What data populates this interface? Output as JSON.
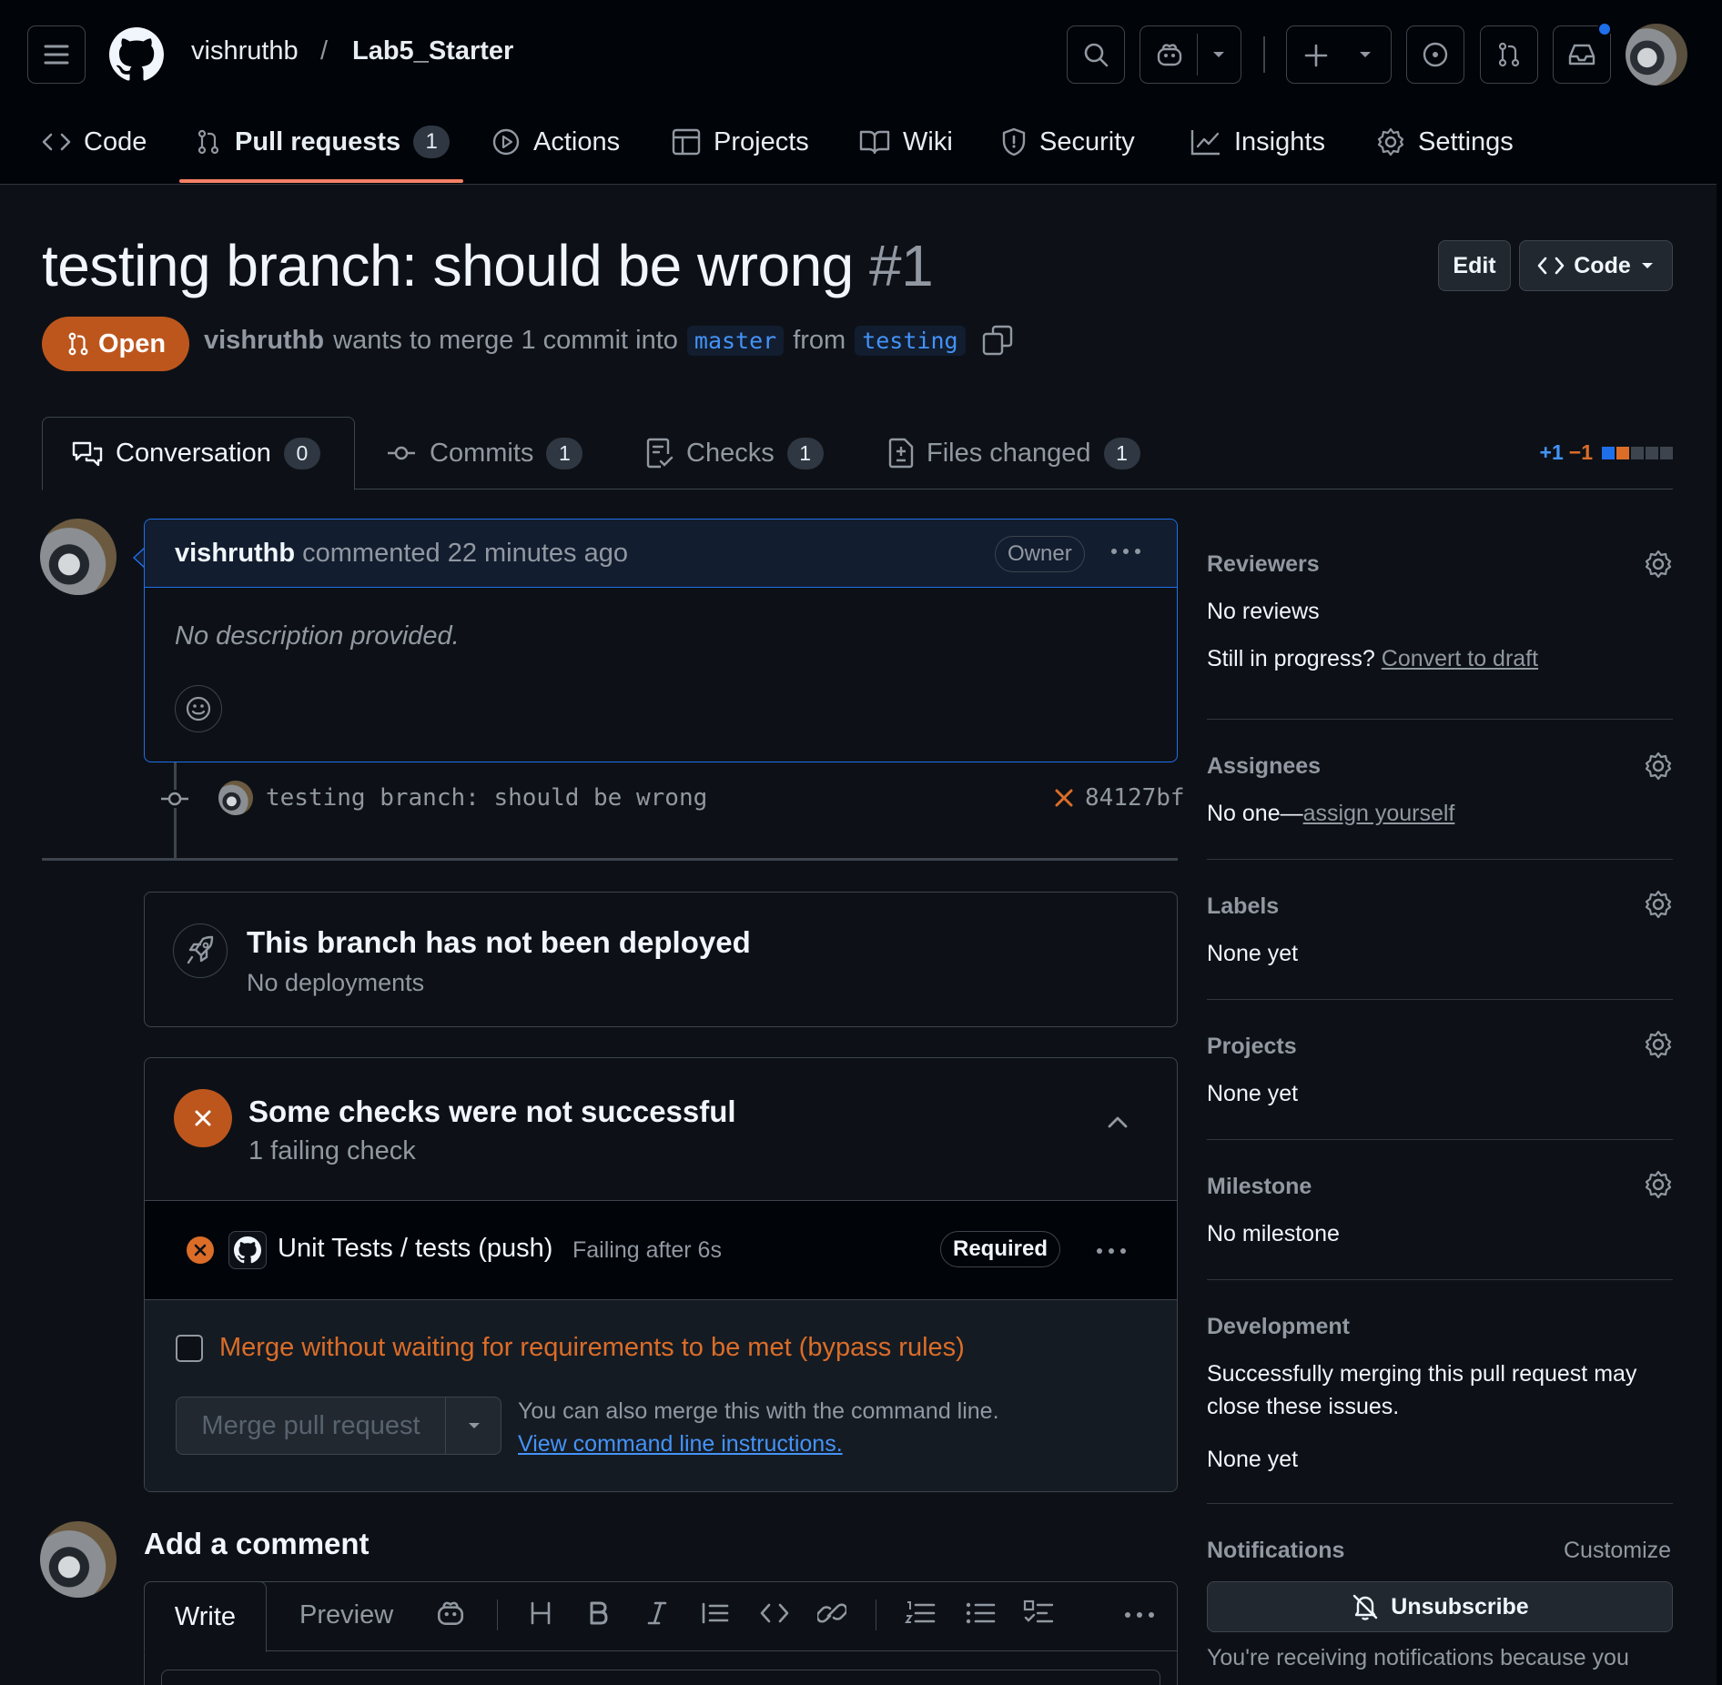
{
  "header": {
    "owner": "vishruthb",
    "separator": "/",
    "repo": "Lab5_Starter"
  },
  "repo_nav": {
    "tabs": [
      {
        "label": "Code"
      },
      {
        "label": "Pull requests",
        "count": "1"
      },
      {
        "label": "Actions"
      },
      {
        "label": "Projects"
      },
      {
        "label": "Wiki"
      },
      {
        "label": "Security"
      },
      {
        "label": "Insights"
      },
      {
        "label": "Settings"
      }
    ]
  },
  "pr": {
    "title": "testing branch: should be wrong",
    "number": "#1",
    "edit_label": "Edit",
    "code_label": "Code",
    "state": "Open",
    "author": "vishruthb",
    "merge_text": "wants to merge 1 commit into",
    "base_branch": "master",
    "from_text": "from",
    "head_branch": "testing"
  },
  "pr_tabs": {
    "conversation": {
      "label": "Conversation",
      "count": "0"
    },
    "commits": {
      "label": "Commits",
      "count": "1"
    },
    "checks": {
      "label": "Checks",
      "count": "1"
    },
    "files": {
      "label": "Files changed",
      "count": "1"
    },
    "additions": "+1",
    "deletions": "−1"
  },
  "comment": {
    "author": "vishruthb",
    "action": "commented 22 minutes ago",
    "badge": "Owner",
    "body": "No description provided."
  },
  "commit": {
    "message": "testing branch: should be wrong",
    "sha": "84127bf"
  },
  "deploy": {
    "title": "This branch has not been deployed",
    "subtitle": "No deployments"
  },
  "checks": {
    "title": "Some checks were not successful",
    "subtitle": "1 failing check",
    "item_name": "Unit Tests / tests (push)",
    "item_status": "Failing after 6s",
    "required": "Required",
    "bypass_label": "Merge without waiting for requirements to be met (bypass rules)",
    "merge_button": "Merge pull request",
    "cli_text": "You can also merge this with the command line.",
    "cli_link": "View command line instructions."
  },
  "add_comment": {
    "title": "Add a comment",
    "write_tab": "Write",
    "preview_tab": "Preview"
  },
  "sidebar": {
    "reviewers_title": "Reviewers",
    "reviewers_value": "No reviews",
    "in_progress": "Still in progress?",
    "convert_draft": "Convert to draft",
    "assignees_title": "Assignees",
    "assignees_prefix": "No one—",
    "assign_yourself": "assign yourself",
    "labels_title": "Labels",
    "labels_value": "None yet",
    "projects_title": "Projects",
    "projects_value": "None yet",
    "milestone_title": "Milestone",
    "milestone_value": "No milestone",
    "development_title": "Development",
    "development_text_1": "Successfully merging this pull request may",
    "development_text_2": "close these issues.",
    "development_value": "None yet",
    "notifications_title": "Notifications",
    "customize": "Customize",
    "unsubscribe": "Unsubscribe",
    "notif_reason": "You're receiving notifications because you"
  },
  "colors": {
    "accent": "#1f6feb",
    "open_state": "#bd561d",
    "danger": "#da3633",
    "attention": "#db6d28"
  }
}
